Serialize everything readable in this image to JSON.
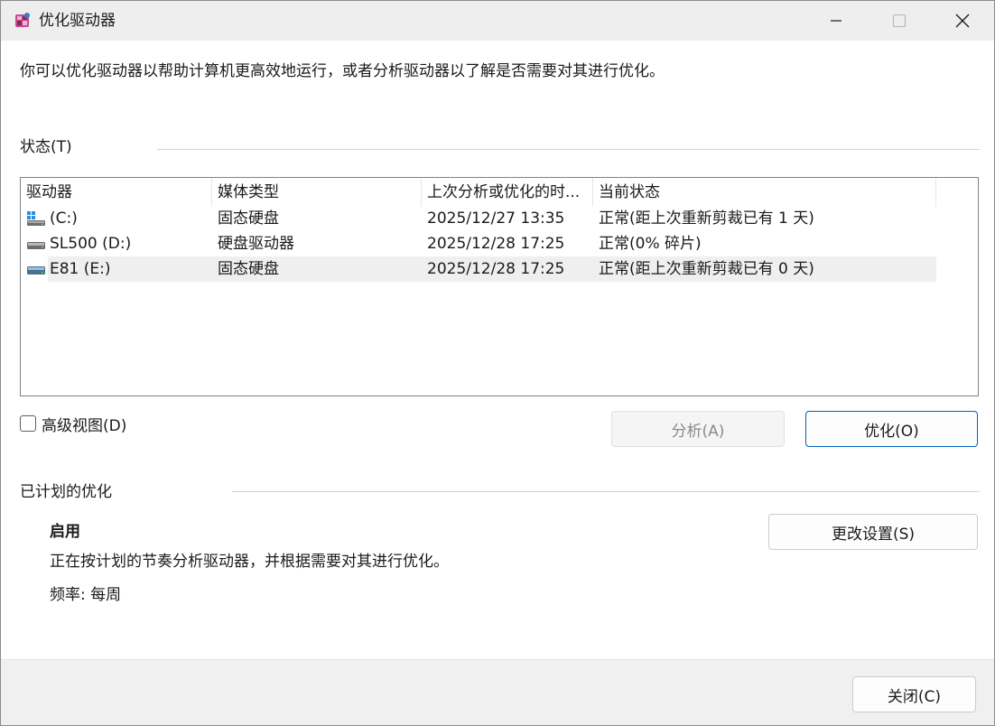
{
  "window": {
    "title": "优化驱动器"
  },
  "description": "你可以优化驱动器以帮助计算机更高效地运行，或者分析驱动器以了解是否需要对其进行优化。",
  "status": {
    "label": "状态(T)",
    "columns": [
      "驱动器",
      "媒体类型",
      "上次分析或优化的时...",
      "当前状态"
    ],
    "rows": [
      {
        "drive": "(C:)",
        "icon": "windows-drive-icon",
        "media": "固态硬盘",
        "last": "2025/12/27 13:35",
        "state": "正常(距上次重新剪裁已有 1 天)"
      },
      {
        "drive": "SL500 (D:)",
        "icon": "hdd-drive-icon",
        "media": "硬盘驱动器",
        "last": "2025/12/28 17:25",
        "state": "正常(0% 碎片)"
      },
      {
        "drive": "E81 (E:)",
        "icon": "ssd-drive-icon",
        "media": "固态硬盘",
        "last": "2025/12/28 17:25",
        "state": "正常(距上次重新剪裁已有 0 天)",
        "selected": true
      }
    ]
  },
  "advanced_view": {
    "label": "高级视图(D)",
    "checked": false
  },
  "buttons": {
    "analyze": "分析(A)",
    "optimize": "优化(O)",
    "change_settings": "更改设置(S)",
    "close": "关闭(C)"
  },
  "schedule": {
    "label": "已计划的优化",
    "title": "启用",
    "description": "正在按计划的节奏分析驱动器，并根据需要对其进行优化。",
    "frequency": "频率: 每周"
  },
  "colors": {
    "accent": "#005fb8",
    "titlebar": "#eeeeee",
    "footer": "#f0f0f0",
    "selected_row": "#efefef"
  }
}
